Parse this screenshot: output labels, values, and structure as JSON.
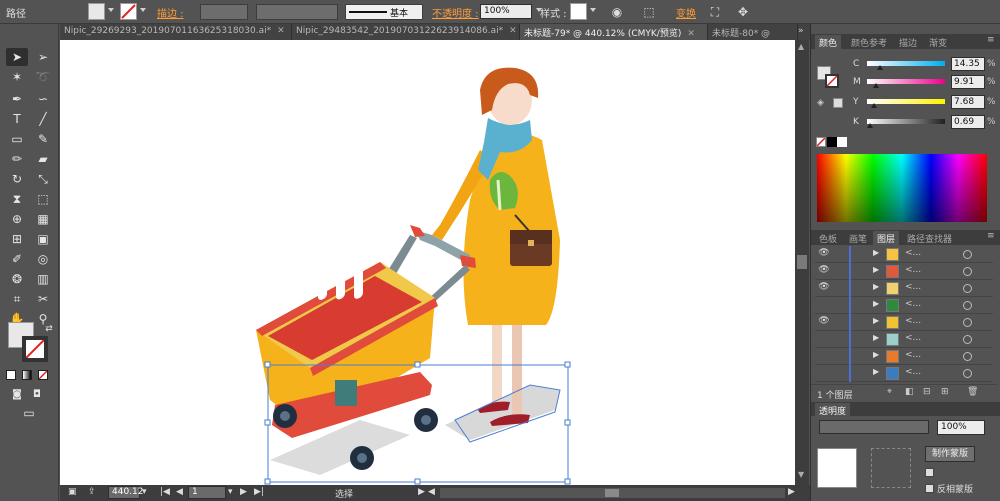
{
  "control_bar": {
    "object_type": "路径",
    "stroke_label": "描边 :",
    "stroke_style": "基本",
    "opacity_label": "不透明度 :",
    "opacity_value": "100%",
    "style_label": "样式 :",
    "transform_label": "变换",
    "icons": [
      "fill-swatch-icon",
      "stroke-none-icon",
      "globe-icon",
      "align-icon",
      "isolate-icon",
      "transform-icon"
    ]
  },
  "tabs": [
    {
      "label": "Nipic_29269293_20190701163625318030.ai*",
      "active": false
    },
    {
      "label": "Nipic_29483542_20190703122623914086.ai*",
      "active": false
    },
    {
      "label": "未标题-79* @ 440.12% (CMYK/预览)",
      "active": true
    },
    {
      "label": "未标题-80* @",
      "active": false
    }
  ],
  "status_bar": {
    "zoom": "440.12",
    "page": "1",
    "tool_status": "选择"
  },
  "color_panel": {
    "tabs": [
      "颜色",
      "颜色参考",
      "描边",
      "渐变"
    ],
    "active_tab": "颜色",
    "channels": [
      {
        "label": "C",
        "value": "14.35",
        "color": "#00aeef"
      },
      {
        "label": "M",
        "value": "9.91",
        "color": "#ec008c"
      },
      {
        "label": "Y",
        "value": "7.68",
        "color": "#fff200"
      },
      {
        "label": "K",
        "value": "0.69",
        "color": "#231f20"
      }
    ]
  },
  "layers_panel": {
    "tabs": [
      "色板",
      "画笔",
      "图层",
      "路径查找器"
    ],
    "active_tab": "图层",
    "footer_label": "1 个图层",
    "rows": [
      {
        "name": "<...",
        "eye": true,
        "thumb": "#f5c242"
      },
      {
        "name": "<...",
        "eye": true,
        "thumb": "#e05a3a"
      },
      {
        "name": "<...",
        "eye": true,
        "thumb": "#f0d070"
      },
      {
        "name": "<...",
        "eye": false,
        "thumb": "#2e8a3e"
      },
      {
        "name": "<...",
        "eye": true,
        "thumb": "#f2c230"
      },
      {
        "name": "<...",
        "eye": false,
        "thumb": "#9ad0c8"
      },
      {
        "name": "<...",
        "eye": false,
        "thumb": "#e87a2a"
      },
      {
        "name": "<...",
        "eye": false,
        "thumb": "#3a7cc0"
      }
    ]
  },
  "transparency_panel": {
    "tab_label": "透明度",
    "opacity_value": "100%",
    "make_mask_button": "制作蒙版",
    "invert_mask_label": "反相蒙版"
  }
}
